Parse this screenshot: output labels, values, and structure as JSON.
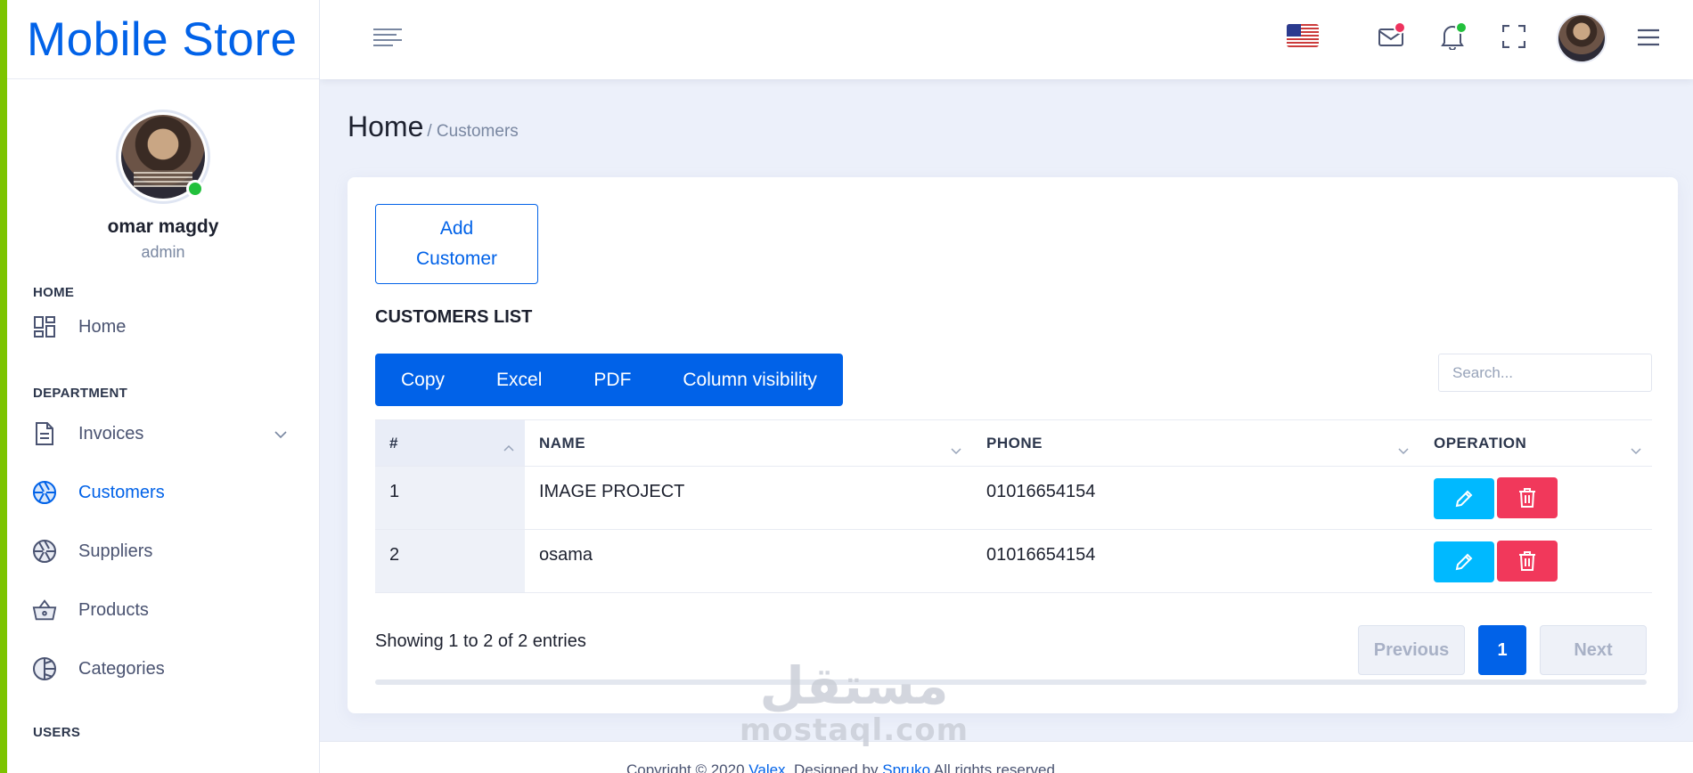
{
  "brand": {
    "title": "Mobile Store"
  },
  "profile": {
    "name": "omar magdy",
    "role": "admin"
  },
  "sidebar": {
    "sections": [
      {
        "label": "HOME"
      },
      {
        "label": "DEPARTMENT"
      },
      {
        "label": "USERS"
      }
    ],
    "items": [
      {
        "label": "Home",
        "icon": "dashboard-icon"
      },
      {
        "label": "Invoices",
        "icon": "document-icon"
      },
      {
        "label": "Customers",
        "icon": "aperture-icon",
        "active": true
      },
      {
        "label": "Suppliers",
        "icon": "aperture-icon"
      },
      {
        "label": "Products",
        "icon": "basket-icon"
      },
      {
        "label": "Categories",
        "icon": "pie-icon"
      }
    ]
  },
  "header": {
    "icons": [
      "hamburger-icon",
      "us-flag-icon",
      "mail-icon",
      "bell-icon",
      "fullscreen-icon",
      "avatar",
      "menu-icon"
    ],
    "colors": {
      "mail_badge": "#ee335e",
      "bell_badge": "#22c03c"
    }
  },
  "breadcrumb": {
    "home": "Home",
    "current": "/ Customers"
  },
  "main": {
    "add_button": "Add Customer",
    "list_title": "CUSTOMERS LIST",
    "export_buttons": [
      "Copy",
      "Excel",
      "PDF",
      "Column visibility"
    ],
    "search_placeholder": "Search...",
    "columns": [
      "#",
      "NAME",
      "PHONE",
      "OPERATION"
    ],
    "rows": [
      {
        "index": "1",
        "name": "IMAGE PROJECT",
        "phone": "01016654154"
      },
      {
        "index": "2",
        "name": "osama",
        "phone": "01016654154"
      }
    ],
    "info": "Showing 1 to 2 of 2 entries",
    "pagination": {
      "previous": "Previous",
      "current": "1",
      "next": "Next"
    }
  },
  "watermark": {
    "arabic": "مستقل",
    "latin": "mostaql.com"
  },
  "footer": {
    "prefix": "Copyright © 2020 ",
    "link1": "Valex",
    "middle": ". Designed by ",
    "link2": "Spruko",
    "suffix": " All rights reserved."
  },
  "colors": {
    "primary": "#0162e8",
    "accent_strip": "#7cc400",
    "edit": "#00b9ff",
    "delete": "#f1385b"
  }
}
